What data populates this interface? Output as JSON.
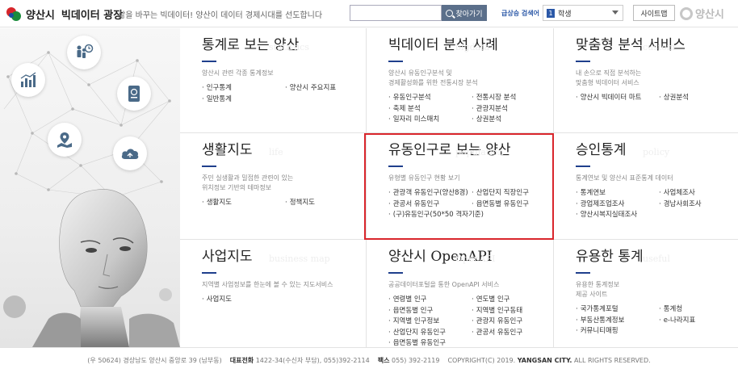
{
  "header": {
    "logo_city": "양산시",
    "logo_name": "빅데이터 광장",
    "slogan": "삶을 바꾸는 빅데이터! 양산이 데이터 경제시대를 선도합니다",
    "search_placeholder": "",
    "search_button": "찾아가기",
    "rank_label": "급상승 검색어",
    "rank_number": "1",
    "rank_term": "학생",
    "sitemap": "사이트맵",
    "right_logo": "양산시"
  },
  "hero": {
    "icons": [
      "family-clock-icon",
      "bar-chart-icon",
      "passport-icon",
      "map-pin-icon",
      "cloud-icon"
    ]
  },
  "cells": [
    {
      "title": "통계로 보는 양산",
      "ghost": "statistics",
      "desc": [
        "양산시 관련 각종 통계정보"
      ],
      "items": [
        "인구통계",
        "양산시 주요지표",
        "일반통계"
      ]
    },
    {
      "title": "빅데이터 분석 사례",
      "ghost": "bigdata",
      "desc": [
        "양산시 유동인구분석 및",
        "경제활성화를 위한 전통시장 분석"
      ],
      "items": [
        "유동인구분석",
        "전통시장 분석",
        "축제 분석",
        "관광지분석",
        "일자리 미스매치",
        "상권분석"
      ]
    },
    {
      "title": "맞춤형 분석 서비스",
      "ghost": "custom",
      "desc": [
        "내 손으로 직접 분석하는",
        "맞춤형 빅데이터 서비스"
      ],
      "items": [
        "양산시 빅데이터 마트",
        "상권분석"
      ]
    },
    {
      "title": "생활지도",
      "ghost": "life",
      "desc": [
        "주민 실생활과 밀접한 관련이 있는",
        "위치정보 기반의 테마정보"
      ],
      "items": [
        "생활지도",
        "정책지도"
      ]
    },
    {
      "title": "유동인구로 보는 양산",
      "ghost": "population",
      "desc": [
        "유형별 유동인구 현황 보기"
      ],
      "items": [
        "관광객 유동인구(양산8경)",
        "산업단지 직장인구",
        "관공서 유동인구",
        "읍면동별 유동인구",
        "(구)유동인구(50*50 격자기준)"
      ]
    },
    {
      "title": "승인통계",
      "ghost": "policy",
      "desc": [
        "통계연보 및 양산시 표준통계 데이터"
      ],
      "items": [
        "통계연보",
        "사업체조사",
        "광업제조업조사",
        "경남사회조사",
        "양산시복지실태조사"
      ]
    },
    {
      "title": "사업지도",
      "ghost": "business map",
      "desc": [
        "지역별 사업정보를 한눈에 볼 수 있는 지도서비스"
      ],
      "items": [
        "사업지도"
      ]
    },
    {
      "title": "양산시 OpenAPI",
      "ghost": "OpenAPI",
      "desc": [
        "공공데이터포털을 통한 OpenAPI 서비스"
      ],
      "items": [
        "연령별 인구",
        "연도별 인구",
        "읍면동별 인구",
        "지역별 인구동태",
        "지역별 인구정보",
        "관광지 유동인구",
        "산업단지 유동인구",
        "관공서 유동인구",
        "읍면동별 유동인구"
      ]
    },
    {
      "title": "유용한 통계",
      "ghost": "useful",
      "desc": [
        "유용한 통계정보",
        "제공 사이트"
      ],
      "items": [
        "국가통계포털",
        "통계청",
        "부동산통계정보",
        "e-나라지표",
        "커뮤니티매핑"
      ]
    }
  ],
  "footer": {
    "address": "(우 50624) 경상남도 양산시 중앙로 39 (남부동)",
    "phone_label": "대표전화",
    "phone": "1422-34(수신자 부담), 055)392-2114",
    "fax_label": "팩스",
    "fax": "055) 392-2119",
    "copyright_pre": "COPYRIGHT(C) 2019.",
    "copyright_brand": "YANGSAN CITY.",
    "copyright_post": "ALL RIGHTS RESERVED."
  }
}
